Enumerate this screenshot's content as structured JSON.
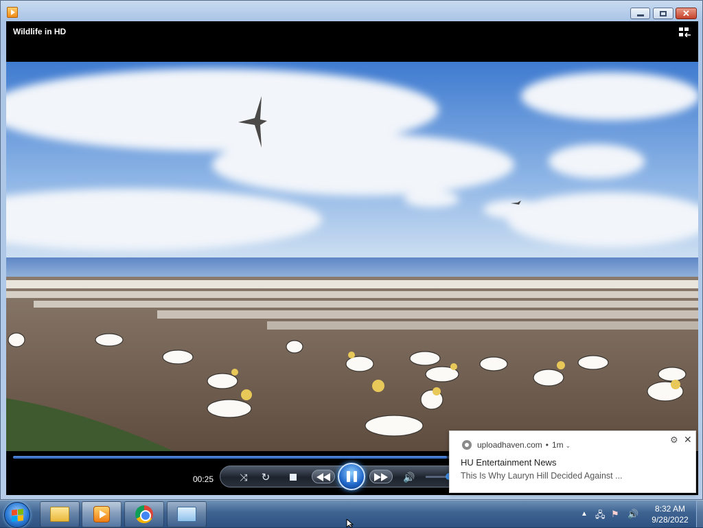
{
  "window": {
    "app_icon": "media-player-icon",
    "buttons": [
      "minimize",
      "maximize",
      "close"
    ]
  },
  "player": {
    "video_title": "Wildlife in HD",
    "switch_view_icon": "switch-to-library-icon",
    "elapsed": "00:25",
    "progress": 0.64,
    "volume_level": 0.75,
    "state": "playing"
  },
  "toast": {
    "source": "uploadhaven.com",
    "separator": "•",
    "age": "1m",
    "title": "HU Entertainment News",
    "body": "This Is Why Lauryn Hill Decided Against ..."
  },
  "taskbar": {
    "items": [
      {
        "name": "windows-explorer",
        "icon": "folder-icon"
      },
      {
        "name": "windows-media-player",
        "icon": "media-player-icon"
      },
      {
        "name": "google-chrome",
        "icon": "chrome-icon"
      },
      {
        "name": "control-panel",
        "icon": "control-panel-icon"
      }
    ]
  },
  "tray": {
    "time": "8:32 AM",
    "date": "9/28/2022"
  },
  "colors": {
    "accent": "#2b5fb8",
    "taskbar": "#3e6391"
  }
}
